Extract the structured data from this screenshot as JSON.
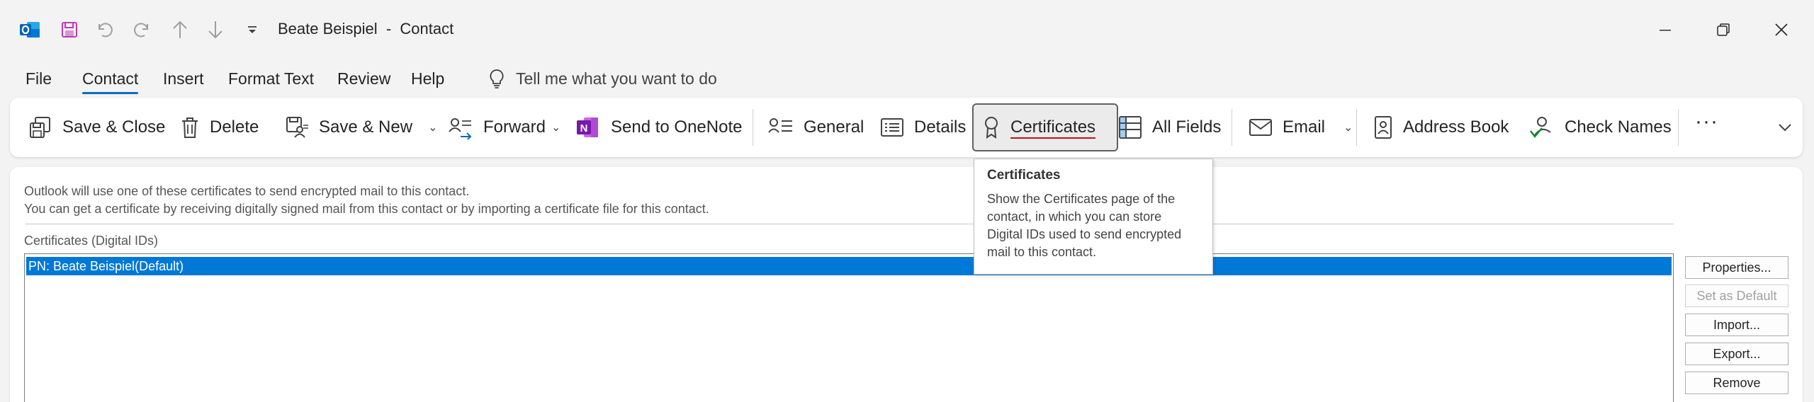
{
  "window": {
    "title": "Beate Beispiel  -  Contact"
  },
  "menu": {
    "tabs": [
      {
        "label": "File"
      },
      {
        "label": "Contact"
      },
      {
        "label": "Insert"
      },
      {
        "label": "Format Text"
      },
      {
        "label": "Review"
      },
      {
        "label": "Help"
      }
    ],
    "active_tab": "Contact",
    "tell_me": "Tell me what you want to do"
  },
  "ribbon": {
    "save_close": "Save & Close",
    "delete": "Delete",
    "save_new": "Save & New",
    "forward": "Forward",
    "send_onenote": "Send to OneNote",
    "general": "General",
    "details": "Details",
    "certificates": "Certificates",
    "all_fields": "All Fields",
    "email": "Email",
    "address_book": "Address Book",
    "check_names": "Check Names",
    "more": "···",
    "onenote_icon_letter": "N"
  },
  "content": {
    "info_line1": "Outlook will use one of these certificates to send encrypted mail to this contact.",
    "info_line2": "You can get a certificate by receiving digitally signed mail from this contact or by importing a certificate file for this contact.",
    "certs_label": "Certificates (Digital IDs)",
    "certs": [
      {
        "name": "PN: Beate Beispiel(Default)",
        "selected": true
      }
    ],
    "buttons": {
      "properties": "Properties...",
      "set_default": "Set as Default",
      "import": "Import...",
      "export": "Export...",
      "remove": "Remove"
    }
  },
  "tooltip": {
    "title": "Certificates",
    "body": "Show the Certificates page of the contact, in which you can store Digital IDs used to send encrypted mail to this contact."
  },
  "colors": {
    "accent": "#0f6cbd",
    "outlook_blue": "#0364b8",
    "onenote_purple": "#7719aa",
    "selection": "#0078d7",
    "underline_red": "#c50f1f"
  }
}
